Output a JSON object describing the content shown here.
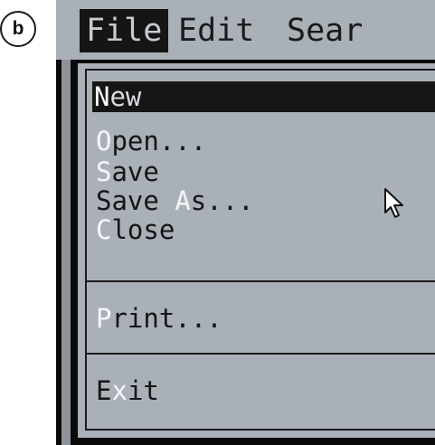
{
  "figure_label": "b",
  "menubar": {
    "items": [
      {
        "label": "File",
        "active": true
      },
      {
        "label": "Edit",
        "active": false
      },
      {
        "label": "Sear",
        "active": false
      }
    ]
  },
  "file_menu": {
    "groups": [
      [
        {
          "label": "New",
          "hotkey": "N",
          "rest": "ew",
          "selected": true
        },
        {
          "label": "Open...",
          "hotkey": "O",
          "rest": "pen...",
          "selected": false
        },
        {
          "label": "Save",
          "hotkey": "S",
          "rest": "ave",
          "selected": false
        },
        {
          "label": "Save As...",
          "before": "Save ",
          "hotkey": "A",
          "rest": "s...",
          "selected": false
        },
        {
          "label": "Close",
          "hotkey": "C",
          "rest": "lose",
          "selected": false
        }
      ],
      [
        {
          "label": "Print...",
          "hotkey": "P",
          "rest": "rint...",
          "selected": false
        }
      ],
      [
        {
          "label": "Exit",
          "before": "E",
          "hotkey": "x",
          "rest": "it",
          "selected": false
        }
      ]
    ]
  },
  "icons": {
    "mouse_cursor": "arrow-pointer-icon"
  },
  "colors": {
    "menu_background": "#aab0b8",
    "selection_background": "#161616",
    "hotkey_highlight": "#f4f6f8",
    "screen_background": "#0a0a0a"
  }
}
